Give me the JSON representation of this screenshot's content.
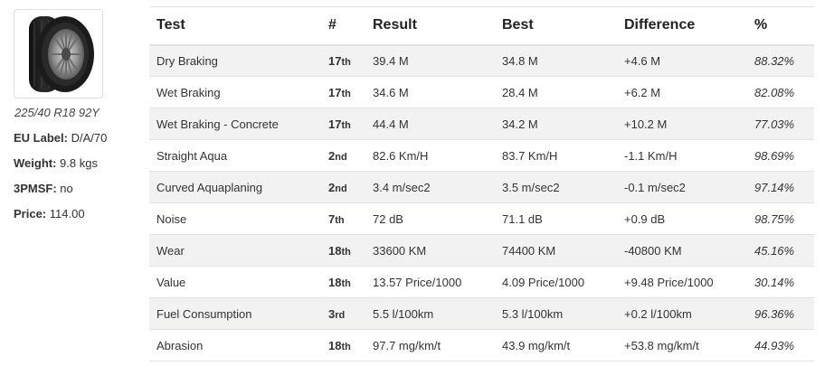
{
  "tyre": {
    "image_icon": "tyre-photo",
    "size": "225/40 R18 92Y",
    "specs": {
      "eu_label_label": "EU Label:",
      "eu_label_value": "D/A/70",
      "weight_label": "Weight:",
      "weight_value": "9.8 kgs",
      "pmsf_label": "3PMSF:",
      "pmsf_value": "no",
      "price_label": "Price:",
      "price_value": "114.00"
    }
  },
  "table": {
    "headers": [
      "Test",
      "#",
      "Result",
      "Best",
      "Difference",
      "%"
    ],
    "rows": [
      {
        "test": "Dry Braking",
        "rank_num": "17",
        "rank_suffix": "th",
        "result": "39.4 M",
        "best": "34.8 M",
        "difference": "+4.6 M",
        "percent": "88.32%"
      },
      {
        "test": "Wet Braking",
        "rank_num": "17",
        "rank_suffix": "th",
        "result": "34.6 M",
        "best": "28.4 M",
        "difference": "+6.2 M",
        "percent": "82.08%"
      },
      {
        "test": "Wet Braking - Concrete",
        "rank_num": "17",
        "rank_suffix": "th",
        "result": "44.4 M",
        "best": "34.2 M",
        "difference": "+10.2 M",
        "percent": "77.03%"
      },
      {
        "test": "Straight Aqua",
        "rank_num": "2",
        "rank_suffix": "nd",
        "result": "82.6 Km/H",
        "best": "83.7 Km/H",
        "difference": "-1.1 Km/H",
        "percent": "98.69%"
      },
      {
        "test": "Curved Aquaplaning",
        "rank_num": "2",
        "rank_suffix": "nd",
        "result": "3.4 m/sec2",
        "best": "3.5 m/sec2",
        "difference": "-0.1 m/sec2",
        "percent": "97.14%"
      },
      {
        "test": "Noise",
        "rank_num": "7",
        "rank_suffix": "th",
        "result": "72 dB",
        "best": "71.1 dB",
        "difference": "+0.9 dB",
        "percent": "98.75%"
      },
      {
        "test": "Wear",
        "rank_num": "18",
        "rank_suffix": "th",
        "result": "33600 KM",
        "best": "74400 KM",
        "difference": "-40800 KM",
        "percent": "45.16%"
      },
      {
        "test": "Value",
        "rank_num": "18",
        "rank_suffix": "th",
        "result": "13.57 Price/1000",
        "best": "4.09 Price/1000",
        "difference": "+9.48 Price/1000",
        "percent": "30.14%"
      },
      {
        "test": "Fuel Consumption",
        "rank_num": "3",
        "rank_suffix": "rd",
        "result": "5.5 l/100km",
        "best": "5.3 l/100km",
        "difference": "+0.2 l/100km",
        "percent": "96.36%"
      },
      {
        "test": "Abrasion",
        "rank_num": "18",
        "rank_suffix": "th",
        "result": "97.7 mg/km/t",
        "best": "43.9 mg/km/t",
        "difference": "+53.8 mg/km/t",
        "percent": "44.93%"
      }
    ]
  },
  "colors": {
    "row_stripe": "#f2f2f2",
    "border": "#dee2e6",
    "text": "#333333"
  }
}
